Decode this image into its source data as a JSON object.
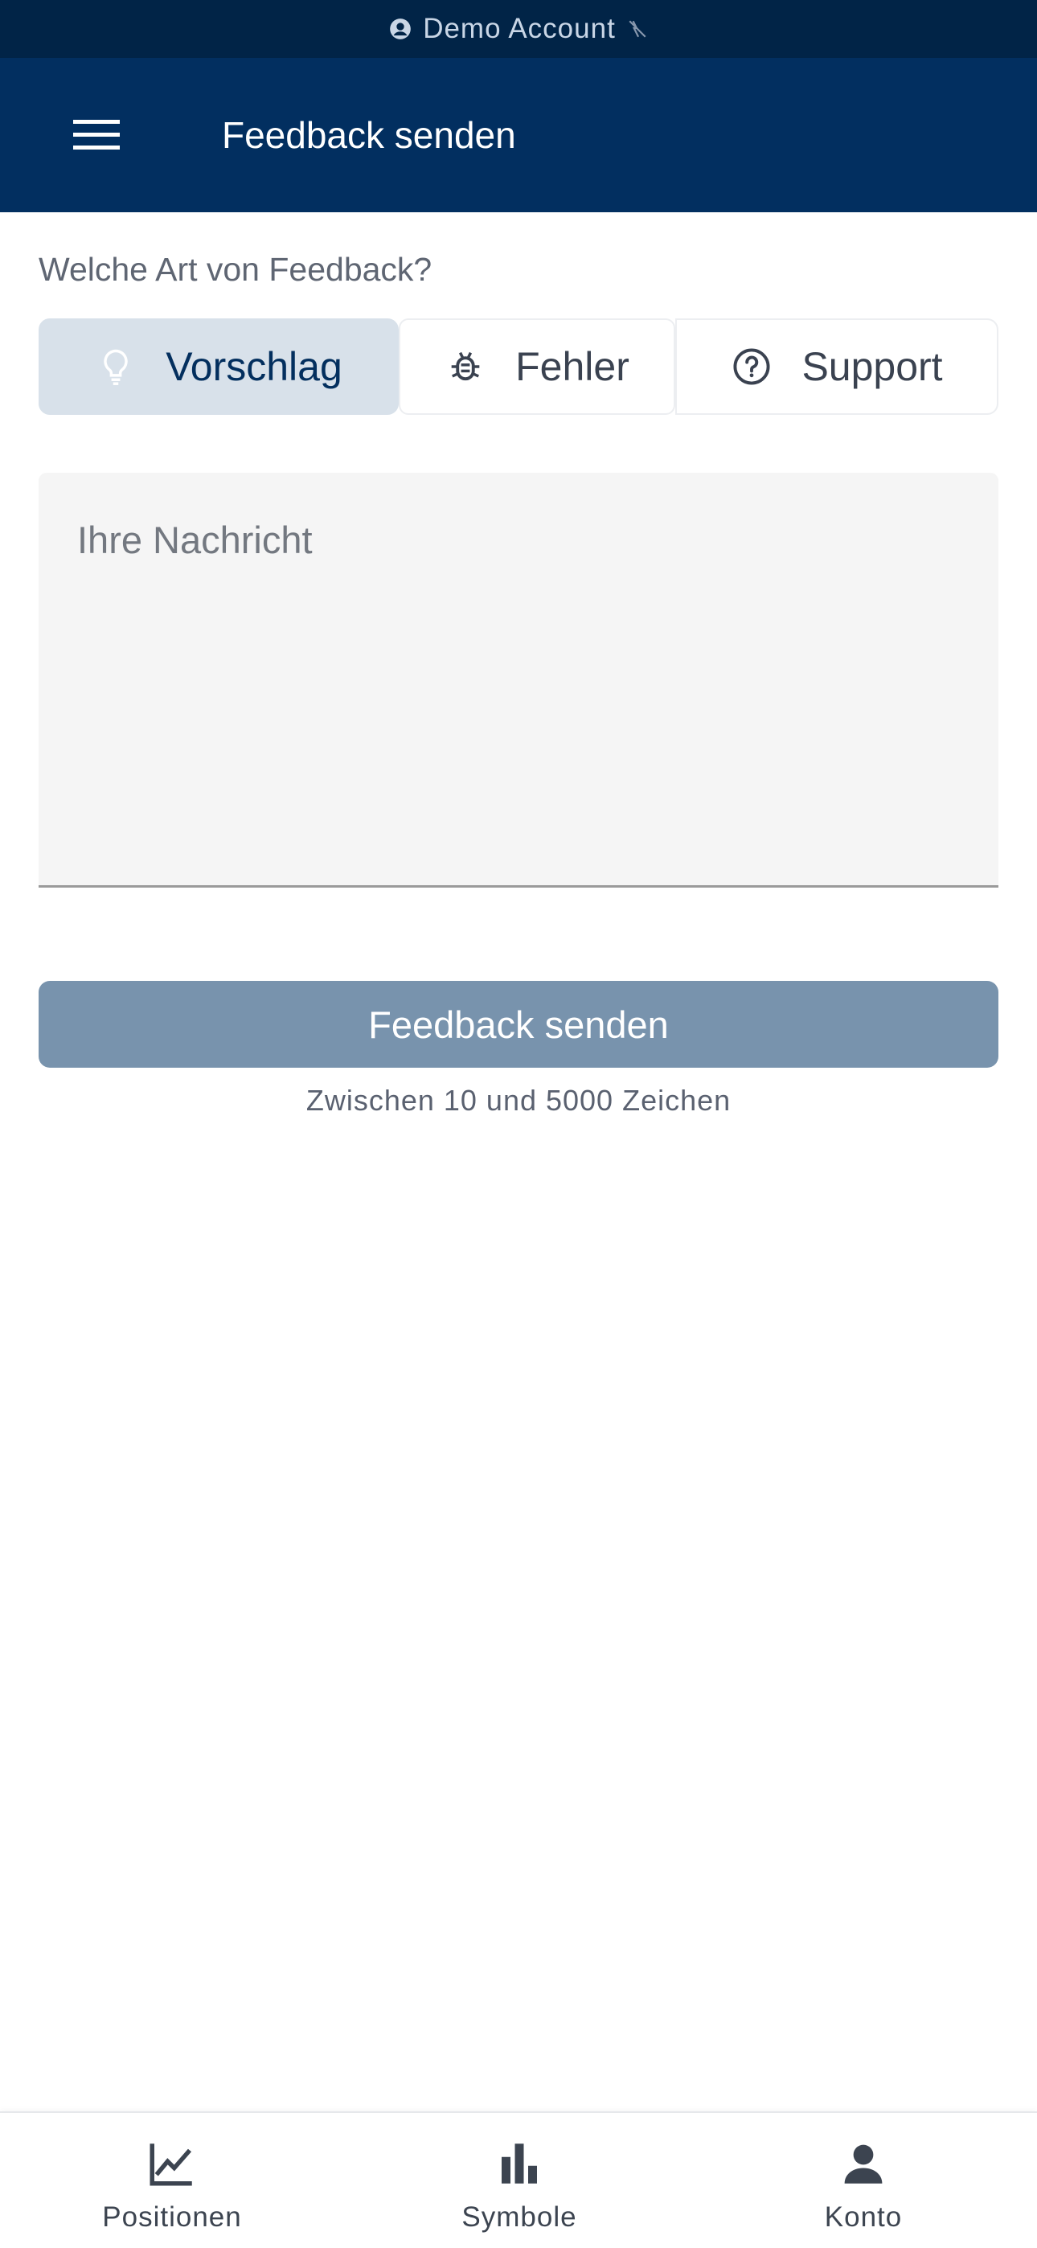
{
  "banner": {
    "text": "Demo Account",
    "person_icon": "account-circle-icon",
    "off_icon": "sync-off-icon"
  },
  "app_bar": {
    "menu_icon": "menu-icon",
    "title": "Feedback senden"
  },
  "feedback_type": {
    "label": "Welche Art von Feedback?",
    "options": [
      {
        "label": "Vorschlag",
        "icon": "lightbulb-icon",
        "selected": true
      },
      {
        "label": "Fehler",
        "icon": "bug-icon",
        "selected": false
      },
      {
        "label": "Support",
        "icon": "help-circle-icon",
        "selected": false
      }
    ]
  },
  "message": {
    "placeholder": "Ihre Nachricht",
    "value": ""
  },
  "submit": {
    "label": "Feedback senden",
    "hint": "Zwischen 10 und 5000 Zeichen"
  },
  "bottom_nav": {
    "items": [
      {
        "label": "Positionen",
        "icon": "chart-line-icon"
      },
      {
        "label": "Symbole",
        "icon": "bar-chart-icon"
      },
      {
        "label": "Konto",
        "icon": "person-icon"
      }
    ]
  },
  "colors": {
    "banner_bg": "#012447",
    "app_bar_bg": "#022f60",
    "selected_segment_bg": "#d8e1ea",
    "submit_disabled_bg": "#7893ad"
  }
}
